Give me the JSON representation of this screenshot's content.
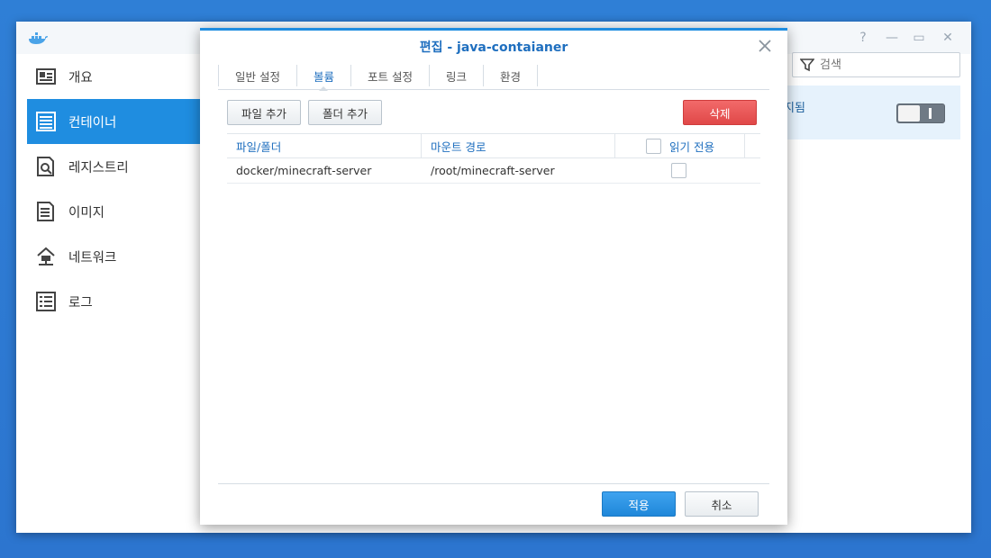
{
  "app": {
    "logo_icon": "docker-whale-icon",
    "controls": [
      "help-icon",
      "minimize-icon",
      "maximize-icon",
      "close-icon"
    ]
  },
  "sidebar": {
    "items": [
      {
        "label": "개요",
        "icon": "overview-icon"
      },
      {
        "label": "컨테이너",
        "icon": "container-icon",
        "active": true
      },
      {
        "label": "레지스트리",
        "icon": "registry-icon"
      },
      {
        "label": "이미지",
        "icon": "image-icon"
      },
      {
        "label": "네트워크",
        "icon": "network-icon"
      },
      {
        "label": "로그",
        "icon": "log-icon"
      }
    ]
  },
  "search": {
    "placeholder": "검색"
  },
  "background_row": {
    "status_fragment": "지됨"
  },
  "dialog": {
    "title": "편집 - java-contaianer",
    "tabs": [
      "일반 설정",
      "볼륨",
      "포트 설정",
      "링크",
      "환경"
    ],
    "active_tab": "볼륨",
    "buttons": {
      "add_file": "파일 추가",
      "add_folder": "폴더 추가",
      "delete": "삭제",
      "apply": "적용",
      "cancel": "취소"
    },
    "table": {
      "headers": {
        "path": "파일/폴더",
        "mount": "마운트 경로",
        "readonly": "읽기 전용"
      },
      "rows": [
        {
          "path": "docker/minecraft-server",
          "mount": "/root/minecraft-server",
          "readonly": false
        }
      ]
    }
  },
  "colors": {
    "accent": "#1f8de0",
    "danger": "#e04848",
    "title": "#1f6fbf"
  }
}
